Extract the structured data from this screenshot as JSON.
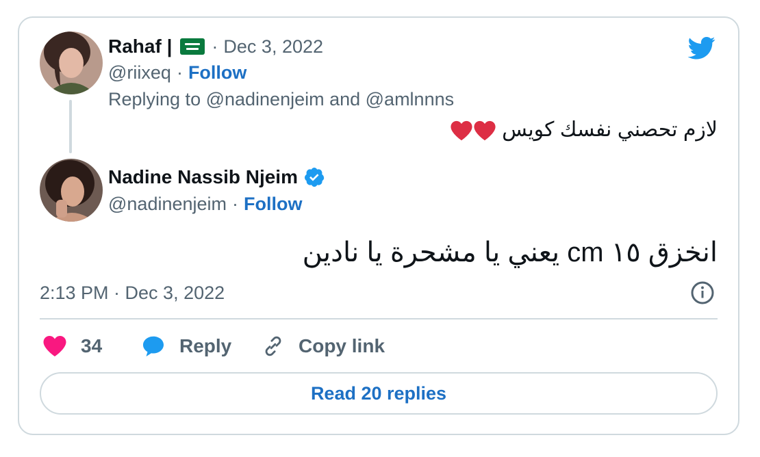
{
  "colors": {
    "accent": "#1d70c4",
    "muted": "#536471",
    "heart": "#f91880",
    "border": "#cfd9de",
    "verified": "#1d9bf0"
  },
  "parent_tweet": {
    "author_name": "Rahaf |",
    "separator": "·",
    "date": "Dec 3, 2022",
    "handle": "@riixeq",
    "follow_label": "Follow",
    "replying_to": "Replying to @nadinenjeim and @amlnnns",
    "text": "لازم تحصني نفسك كويس",
    "emoji": "red-heart"
  },
  "main_tweet": {
    "author_name": "Nadine Nassib Njeim",
    "verified": true,
    "handle": "@nadinenjeim",
    "follow_label": "Follow",
    "text": "انخزق ١٥ cm يعني يا مشحرة يا نادين",
    "timestamp": "2:13 PM · Dec 3, 2022"
  },
  "actions": {
    "like_count": "34",
    "reply_label": "Reply",
    "copy_link_label": "Copy link"
  },
  "read_replies_label": "Read 20 replies",
  "icons": {
    "logo": "twitter-bird-icon",
    "info": "info-icon",
    "like": "heart-icon",
    "reply": "reply-bubble-icon",
    "copy": "link-icon",
    "verified": "verified-badge-icon"
  }
}
